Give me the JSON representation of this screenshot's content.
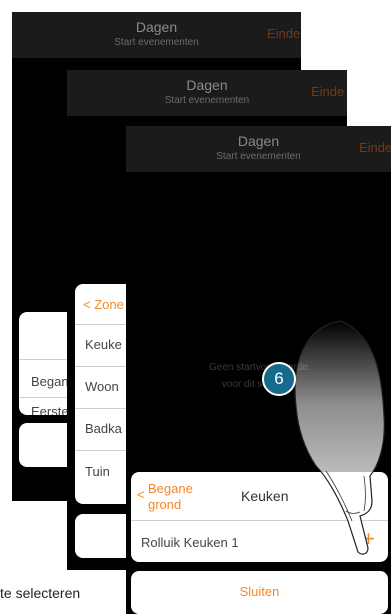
{
  "colors": {
    "accent": "#f18a2b",
    "badge": "#176a8c",
    "header": "#1b1b1b"
  },
  "screen_1": {
    "header": {
      "title": "Dagen",
      "subtitle": "Start evenementen",
      "done": "Einde"
    },
    "floors": [
      "Began",
      "Eerste"
    ]
  },
  "screen_2": {
    "header": {
      "title": "Dagen",
      "subtitle": "Start evenementen",
      "done": "Einde"
    },
    "back_label": "Zone",
    "rooms": [
      "Keuke",
      "Woon",
      "Badka",
      "Tuin"
    ]
  },
  "screen_3": {
    "header": {
      "title": "Dagen",
      "subtitle": "Start evenementen",
      "done": "Einde"
    },
    "empty_line1": "Geen startvoorwaarde",
    "empty_line2": "voor dit scenario",
    "panel": {
      "back_line1": "Begane",
      "back_line2": "grond",
      "title": "Keuken",
      "item": "Rolluik Keuken 1",
      "add_symbol": "+",
      "close": "Sluiten"
    },
    "step_badge": "6",
    "icon": "pointing-hand-icon"
  },
  "caption": "te selecteren"
}
